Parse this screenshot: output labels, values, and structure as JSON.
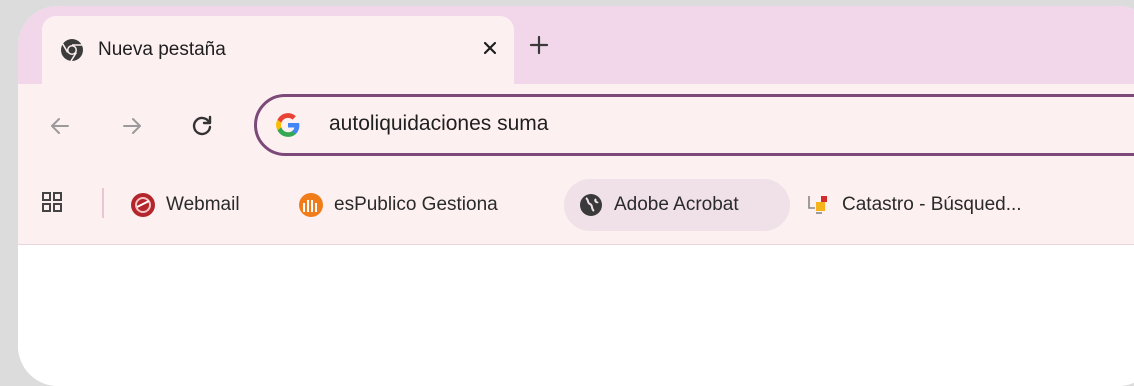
{
  "tab": {
    "title": "Nueva pestaña"
  },
  "omnibox": {
    "query": "autoliquidaciones suma"
  },
  "bookmarks": [
    {
      "label": "Webmail",
      "icon": "webmail-icon"
    },
    {
      "label": "esPublico Gestiona",
      "icon": "espublico-icon"
    },
    {
      "label": "Adobe Acrobat",
      "icon": "globe-icon"
    },
    {
      "label": "Catastro - Búsqued...",
      "icon": "catastro-icon"
    }
  ],
  "colors": {
    "tabstrip": "#f2d7ea",
    "toolbar": "#fdf0f1",
    "omnibox_border": "#7b4a78"
  }
}
